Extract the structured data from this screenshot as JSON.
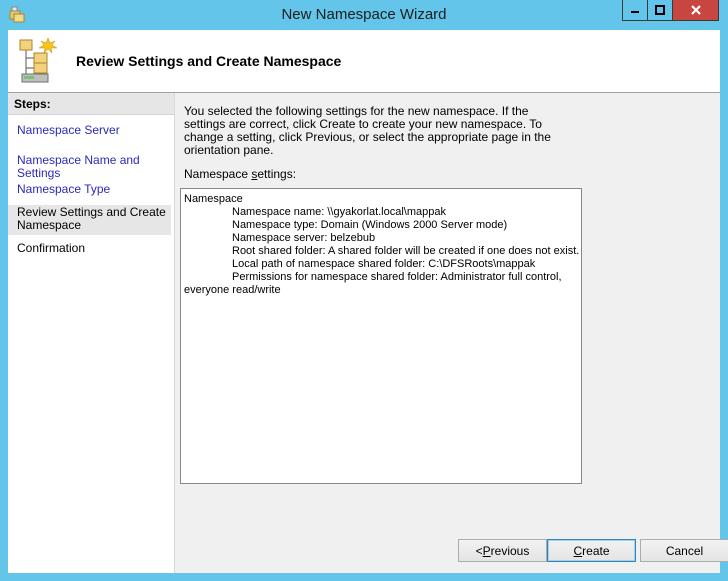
{
  "window": {
    "title": "New Namespace Wizard"
  },
  "header": {
    "title": "Review Settings and Create Namespace"
  },
  "steps": {
    "heading": "Steps:",
    "items": [
      {
        "label": "Namespace Server",
        "state": "link"
      },
      {
        "label": "Namespace Name and Settings",
        "state": "link"
      },
      {
        "label": "Namespace Type",
        "state": "link"
      },
      {
        "label": "Review Settings and Create Namespace",
        "state": "current"
      },
      {
        "label": "Confirmation",
        "state": "pending"
      }
    ]
  },
  "main": {
    "description": "You selected the following settings for the new namespace. If the settings are correct, click Create to create your new namespace. To change a setting, click Previous, or select the appropriate page in the orientation pane.",
    "settings_label_prefix": "Namespace ",
    "settings_label_accel": "s",
    "settings_label_suffix": "ettings:",
    "settings": {
      "line0": "Namespace",
      "line1": "Namespace name: \\\\gyakorlat.local\\mappak",
      "line2": "Namespace type:  Domain (Windows 2000 Server mode)",
      "line3": "Namespace server: belzebub",
      "line4": "Root shared folder:  A shared folder will be created if one does not exist.",
      "line5": "Local path of namespace shared folder: C:\\DFSRoots\\mappak",
      "line6": "Permissions for namespace shared folder: Administrator full control,",
      "line7": "everyone read/write"
    }
  },
  "buttons": {
    "previous_lt": "< ",
    "previous_accel": "P",
    "previous_rest": "revious",
    "create_accel": "C",
    "create_rest": "reate",
    "cancel": "Cancel"
  },
  "colors": {
    "title_bar": "#63c5ea",
    "close_button": "#c7463f",
    "link": "#2a2ab8"
  }
}
